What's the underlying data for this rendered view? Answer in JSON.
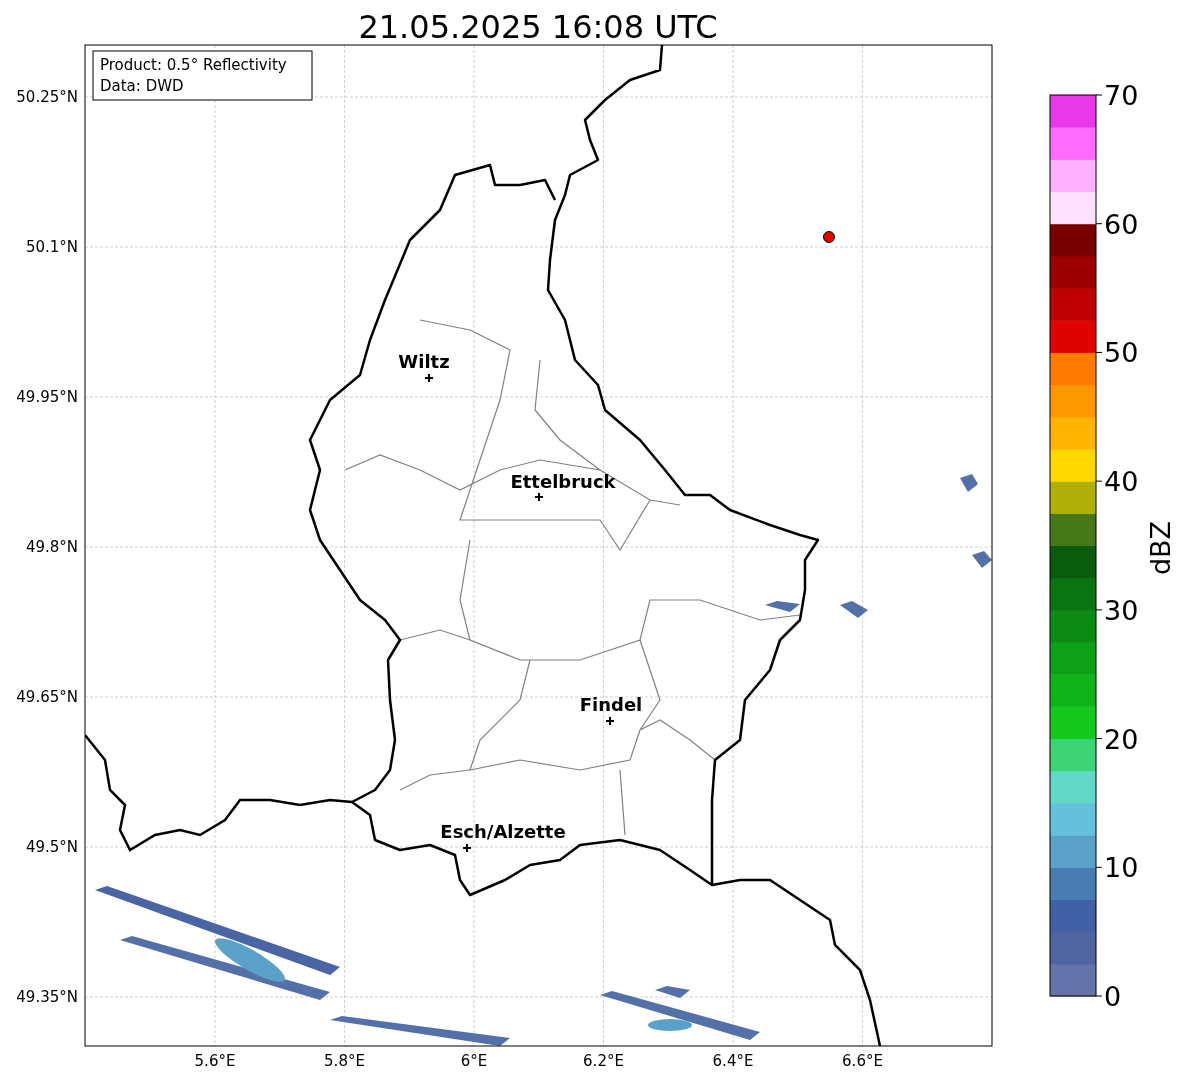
{
  "title": "21.05.2025 16:08 UTC",
  "info_box": [
    "Product: 0.5° Reflectivity",
    "Data: DWD"
  ],
  "y_ticks": [
    "50.25°N",
    "50.1°N",
    "49.95°N",
    "49.8°N",
    "49.65°N",
    "49.5°N",
    "49.35°N"
  ],
  "x_ticks": [
    "5.6°E",
    "5.8°E",
    "6°E",
    "6.2°E",
    "6.4°E",
    "6.6°E"
  ],
  "cities": [
    {
      "name": "Wiltz"
    },
    {
      "name": "Ettelbruck"
    },
    {
      "name": "Findel"
    },
    {
      "name": "Esch/Alzette"
    }
  ],
  "colorbar": {
    "label": "dBZ",
    "ticks": [
      "70",
      "60",
      "50",
      "40",
      "30",
      "20",
      "10",
      "0"
    ]
  }
}
